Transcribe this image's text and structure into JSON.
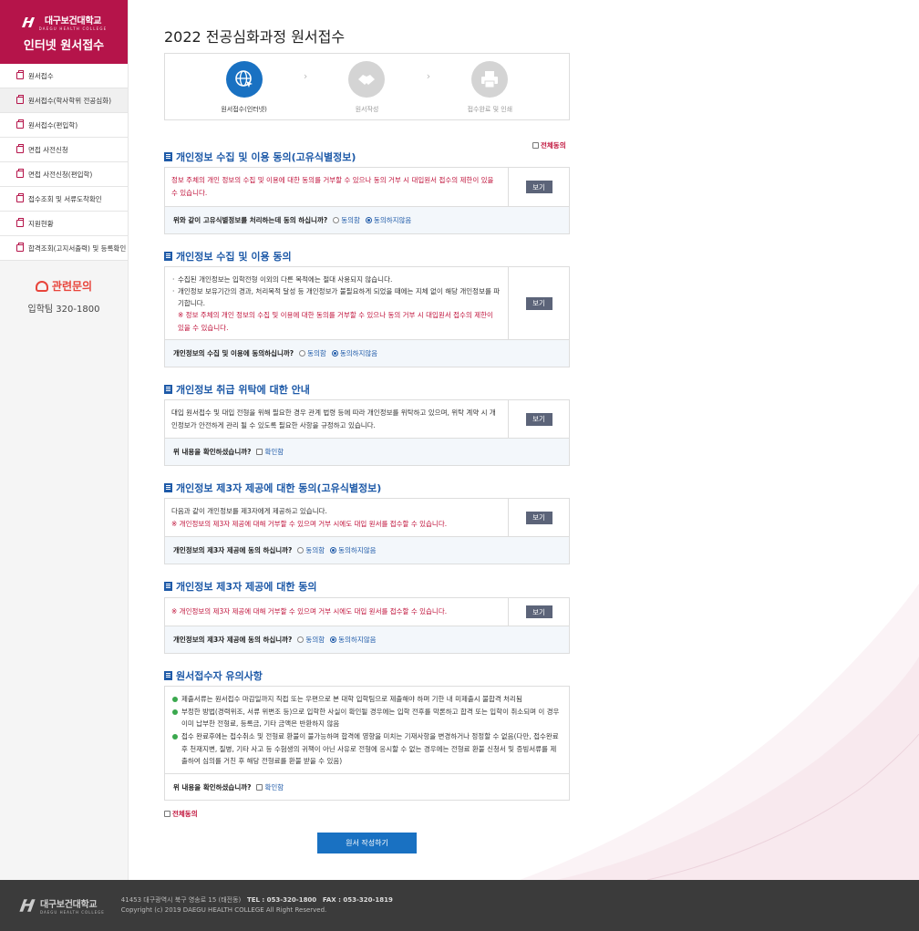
{
  "sidebar": {
    "logo_ko": "대구보건대학교",
    "logo_en": "DAEGU HEALTH COLLEGE",
    "title": "인터넷 원서접수",
    "items": [
      {
        "label": "원서접수"
      },
      {
        "label": "원서접수(학사학위 전공심화)"
      },
      {
        "label": "원서접수(편입학)"
      },
      {
        "label": "면접 사전신청"
      },
      {
        "label": "면접 사전신청(편입학)"
      },
      {
        "label": "접수조회 및 서류도착확인"
      },
      {
        "label": "지원현황"
      },
      {
        "label": "합격조회(고지서출력) 및 등록확인"
      }
    ],
    "contact_title": "관련문의",
    "contact_number": "입학팀 320-1800"
  },
  "page_title": "2022 전공심화과정 원서접수",
  "steps": [
    {
      "label": "원서접수(인터넷)",
      "icon": "globe-icon"
    },
    {
      "label": "원서작성",
      "icon": "handshake-icon"
    },
    {
      "label": "접수완료 및 인쇄",
      "icon": "printer-icon"
    }
  ],
  "all_agree_label": "전체동의",
  "view_label": "보기",
  "options": {
    "agree": "동의함",
    "disagree": "동의하지않음",
    "confirm": "확인함"
  },
  "sections": {
    "s1": {
      "title": "개인정보 수집 및 이용 동의(고유식별정보)",
      "text": "정보 주체의 개인 정보의 수집 및 이용에 대한 동의를 거부할 수 있으나 동의 거부 시 대입원서 접수의 제한이 있을 수 있습니다.",
      "question": "위와 같이 고유식별정보를 처리하는데 동의 하십니까?"
    },
    "s2": {
      "title": "개인정보 수집 및 이용 동의",
      "bullet1": "수집된 개인정보는 입학전형 이외의 다른 목적에는 절대 사용되지 않습니다.",
      "bullet2": "개인정보 보유기간의 경과, 처리목적 달성 등 개인정보가 불필요하게 되었을 때에는 지체 없이 해당 개인정보를 파기합니다.",
      "note": "※ 정보 주체의 개인 정보의 수집 및 이용에 대한 동의를 거부할 수 있으나 동의 거부 시 대입원서 접수의 제한이 있을 수 있습니다.",
      "question": "개인정보의 수집 및 이용에 동의하십니까?"
    },
    "s3": {
      "title": "개인정보 취급 위탁에 대한 안내",
      "text": "대입 원서접수 및 대입 전형을 위해 필요한 경우 관계 법령 등에 따라 개인정보를 위탁하고 있으며, 위탁 계약 시 개인정보가 안전하게 관리 될 수 있도록 필요한 사항을 규정하고 있습니다.",
      "question": "위 내용을 확인하셨습니까?"
    },
    "s4": {
      "title": "개인정보 제3자 제공에 대한 동의(고유식별정보)",
      "text": "다음과 같이 개인정보를 제3자에게 제공하고 있습니다.",
      "note": "※ 개인정보의 제3자 제공에 대해 거부할 수 있으며 거부 시에도 대입 원서를 접수할 수 있습니다.",
      "question": "개인정보의 제3자 제공에 동의 하십니까?"
    },
    "s5": {
      "title": "개인정보 제3자 제공에 대한 동의",
      "note": "※ 개인정보의 제3자 제공에 대해 거부할 수 있으며 거부 시에도 대입 원서를 접수할 수 있습니다.",
      "question": "개인정보의 제3자 제공에 동의 하십니까?"
    },
    "s6": {
      "title": "원서접수자 유의사항",
      "items": [
        "제출서류는 원서접수 마감일까지 직접 또는 우편으로 본 대학 입학팀으로 제출해야 하며 기한 내 미제출시 불합격 처리됨",
        "부정한 방법(경력위조, 서류 위변조 등)으로 입학한 사실이 확인될 경우에는 입학 전후를 막론하고 합격 또는 입학이 취소되며 이 경우 이미 납부한 전형료, 등록금, 기타 금액은 반환하지 않음",
        "접수 완료후에는 접수취소 및 전형료 환불이 불가능하며 합격에 영향을 미치는 기재사항을 변경하거나 정정할 수 없음(다만, 접수완료후 천재지변, 질병, 기타 사고 등 수험생의 귀책이 아닌 사유로 전형에 응시할 수 없는 경우에는 전형료 환불 신청서 및 증빙서류를 제출하여 심의를 거친 후 해당 전형료를 환불 받을 수 있음)"
      ],
      "question": "위 내용을 확인하셨습니까?"
    }
  },
  "submit_label": "원서 작성하기",
  "footer": {
    "logo_ko": "대구보건대학교",
    "logo_en": "DAEGU HEALTH COLLEGE",
    "address": "41453 대구광역시 북구 영송로 15 (태전동)",
    "tel_label": "TEL : 053-320-1800",
    "fax_label": "FAX : 053-320-1819",
    "copyright": "Copyright (c) 2019 DAEGU HEALTH COLLEGE All Right Reserved."
  }
}
